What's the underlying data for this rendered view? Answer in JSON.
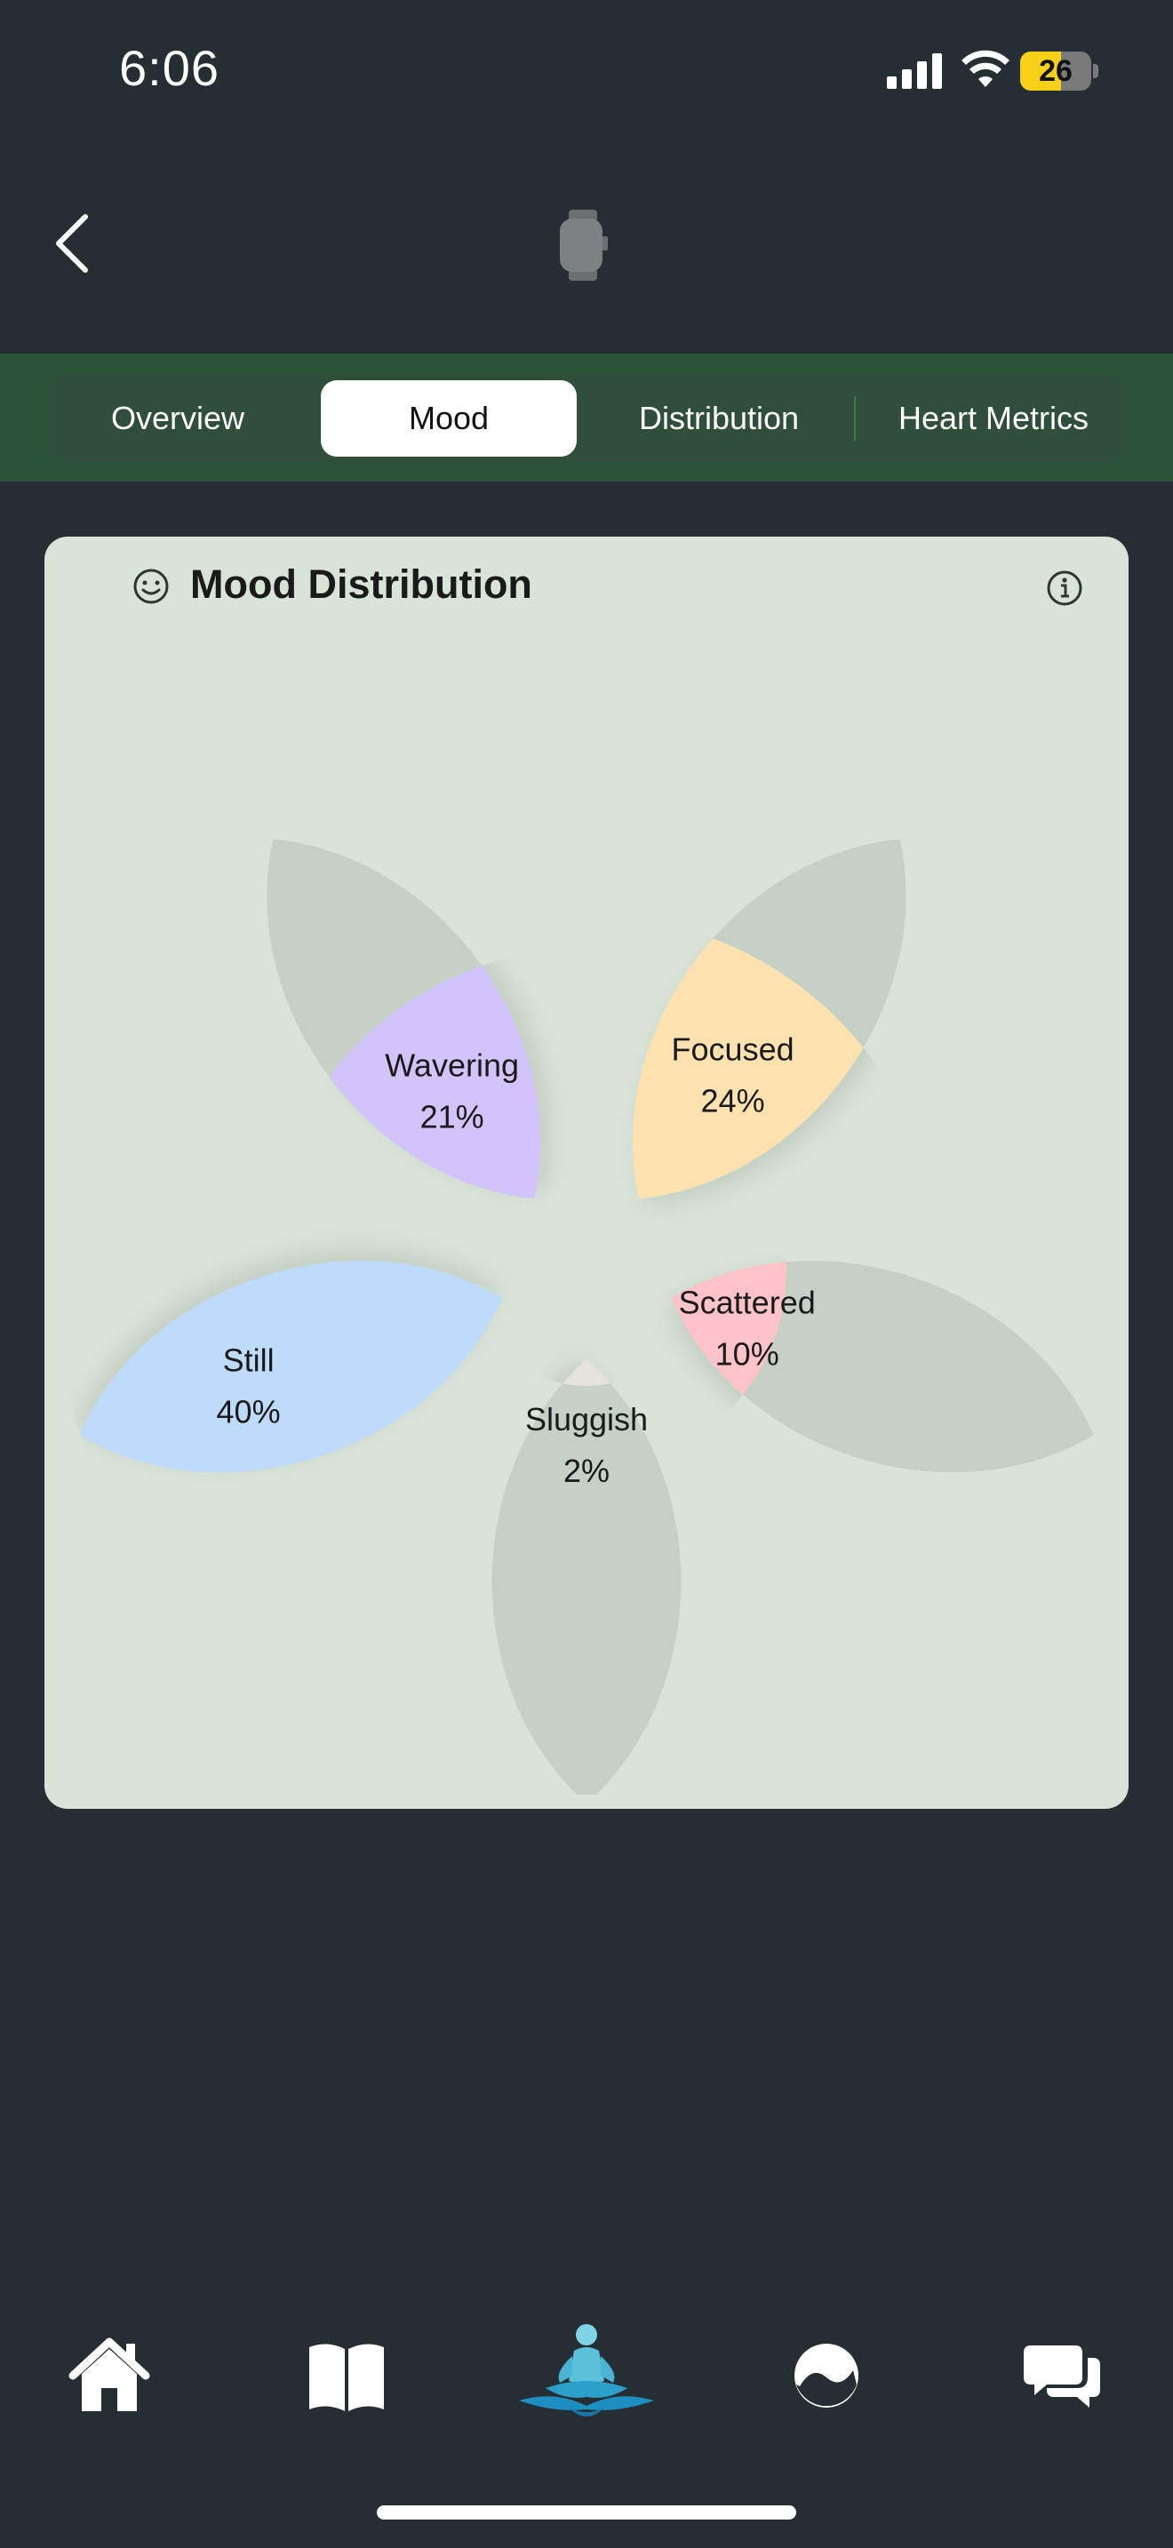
{
  "status": {
    "time": "6:06",
    "battery": "26"
  },
  "tabs": [
    {
      "label": "Overview",
      "active": false
    },
    {
      "label": "Mood",
      "active": true
    },
    {
      "label": "Distribution",
      "active": false
    },
    {
      "label": "Heart Metrics",
      "active": false
    }
  ],
  "card": {
    "title": "Mood Distribution"
  },
  "chart_data": {
    "type": "pie",
    "title": "Mood Distribution",
    "categories": [
      "Focused",
      "Scattered",
      "Sluggish",
      "Still",
      "Wavering"
    ],
    "values": [
      24,
      10,
      2,
      40,
      21
    ],
    "value_labels": [
      "24%",
      "10%",
      "2%",
      "40%",
      "21%"
    ],
    "colors": [
      "#fde2b0",
      "#fdc3c7",
      "#e6e2dd",
      "#bfdbfb",
      "#d3c3fb"
    ],
    "track_color": "#c5d1c6"
  },
  "nav": [
    {
      "icon": "home-icon",
      "active": false
    },
    {
      "icon": "book-icon",
      "active": false
    },
    {
      "icon": "meditation-icon",
      "active": true
    },
    {
      "icon": "wave-circle-icon",
      "active": false
    },
    {
      "icon": "chat-icon",
      "active": false
    }
  ]
}
